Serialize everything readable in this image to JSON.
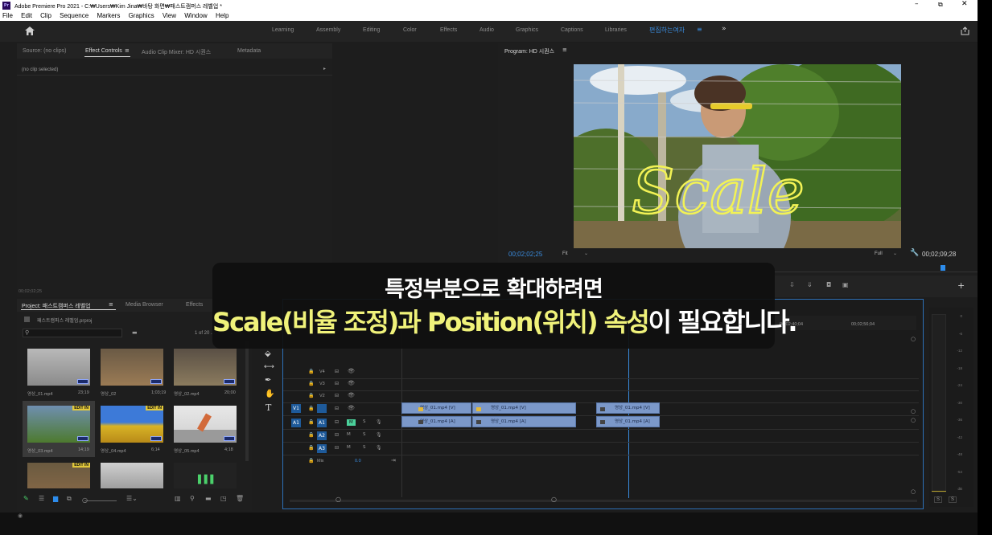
{
  "window": {
    "title": "Adobe Premiere Pro 2021 - C:₩Users₩Kim Jina₩바탕 화면₩패스트캠퍼스 레벨업 *",
    "app_icon": "Pr"
  },
  "menu": [
    "File",
    "Edit",
    "Clip",
    "Sequence",
    "Markers",
    "Graphics",
    "View",
    "Window",
    "Help"
  ],
  "workspaces": [
    "Learning",
    "Assembly",
    "Editing",
    "Color",
    "Effects",
    "Audio",
    "Graphics",
    "Captions",
    "Libraries"
  ],
  "workspace_active": "편집하는여자",
  "source_panel": {
    "tabs": [
      "Source: (no clips)",
      "Effect Controls",
      "Audio Clip Mixer: HD 시퀀스",
      "Metadata"
    ],
    "no_clip": "(no clip selected)",
    "timecode": "00;02;02;25"
  },
  "program": {
    "title": "Program: HD 시퀀스",
    "timecode": "00;02;02;25",
    "fit": "Fit",
    "quality": "Full",
    "duration": "00;02;09;28",
    "overlay_text": "Scale"
  },
  "project": {
    "tabs": [
      "Project: 패스트캠퍼스 레벨업",
      "Media Browser",
      "Effects"
    ],
    "file": "패스트캠퍼스 레벨업.prproj",
    "count": "1 of 20 ...",
    "items": [
      {
        "name": "영상_01.mp4",
        "duration": "23;19",
        "badge": ""
      },
      {
        "name": "영상_02",
        "duration": "1;03;19",
        "badge": ""
      },
      {
        "name": "영상_02.mp4",
        "duration": "20;00",
        "badge": ""
      },
      {
        "name": "영상_03.mp4",
        "duration": "14;19",
        "badge": "EDIT IN"
      },
      {
        "name": "영상_04.mp4",
        "duration": "6;14",
        "badge": "EDIT IN"
      },
      {
        "name": "영상_05.mp4",
        "duration": "4;18",
        "badge": ""
      },
      {
        "name": "",
        "duration": "",
        "badge": "EDIT IN"
      },
      {
        "name": "",
        "duration": "",
        "badge": ""
      },
      {
        "name": "",
        "duration": "",
        "badge": ""
      }
    ]
  },
  "timeline": {
    "ruler": [
      "00;02;40;04",
      "00;02;56;04"
    ],
    "video_tracks": [
      "V4",
      "V3",
      "V2",
      "V1"
    ],
    "audio_tracks": [
      "A1",
      "A2",
      "A3"
    ],
    "mix": "Mix",
    "mix_value": "0.0",
    "src_v": "V1",
    "src_a": "A1",
    "clips_v": [
      "영상_01.mp4 [V]",
      "영상_01.mp4 [V]",
      "영상_01.mp4 [V]"
    ],
    "clips_a": [
      "영상_01.mp4 [A]",
      "영상_01.mp4 [A]",
      "영상_01.mp4 [A]"
    ]
  },
  "meter": {
    "ticks": [
      "0",
      "-6",
      "-12",
      "-18",
      "-24",
      "-30",
      "-36",
      "-42",
      "-48",
      "-54",
      "dB"
    ],
    "solo": [
      "S",
      "S"
    ]
  },
  "subtitle": {
    "line1": "특정부분으로 확대하려면",
    "line2_highlight": "Scale(비율 조정)과 Position(위치) 속성",
    "line2_rest": "이 필요합니다."
  },
  "colors": {
    "accent": "#2d8ceb",
    "clip": "#7b98c9",
    "highlight": "#f0f27a",
    "workspace_active": "#3a8cdf"
  }
}
